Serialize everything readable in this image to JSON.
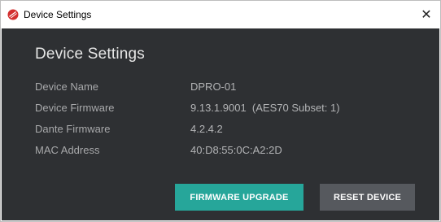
{
  "window": {
    "title": "Device Settings",
    "close_glyph": "✕"
  },
  "dialog": {
    "heading": "Device Settings",
    "rows": [
      {
        "label": "Device Name",
        "value": "DPRO-01"
      },
      {
        "label": "Device Firmware",
        "value": "9.13.1.9001  (AES70 Subset: 1)"
      },
      {
        "label": "Dante Firmware",
        "value": "4.2.4.2"
      },
      {
        "label": "MAC Address",
        "value": "40:D8:55:0C:A2:2D"
      }
    ],
    "buttons": {
      "firmware_upgrade": "FIRMWARE UPGRADE",
      "reset_device": "RESET DEVICE"
    }
  },
  "icons": {
    "app": "red-disc-app-icon",
    "close": "close-icon"
  },
  "colors": {
    "panel_bg": "#2e3033",
    "primary_button": "#26a69a",
    "secondary_button": "#56595e",
    "app_icon": "#d32f2f"
  }
}
